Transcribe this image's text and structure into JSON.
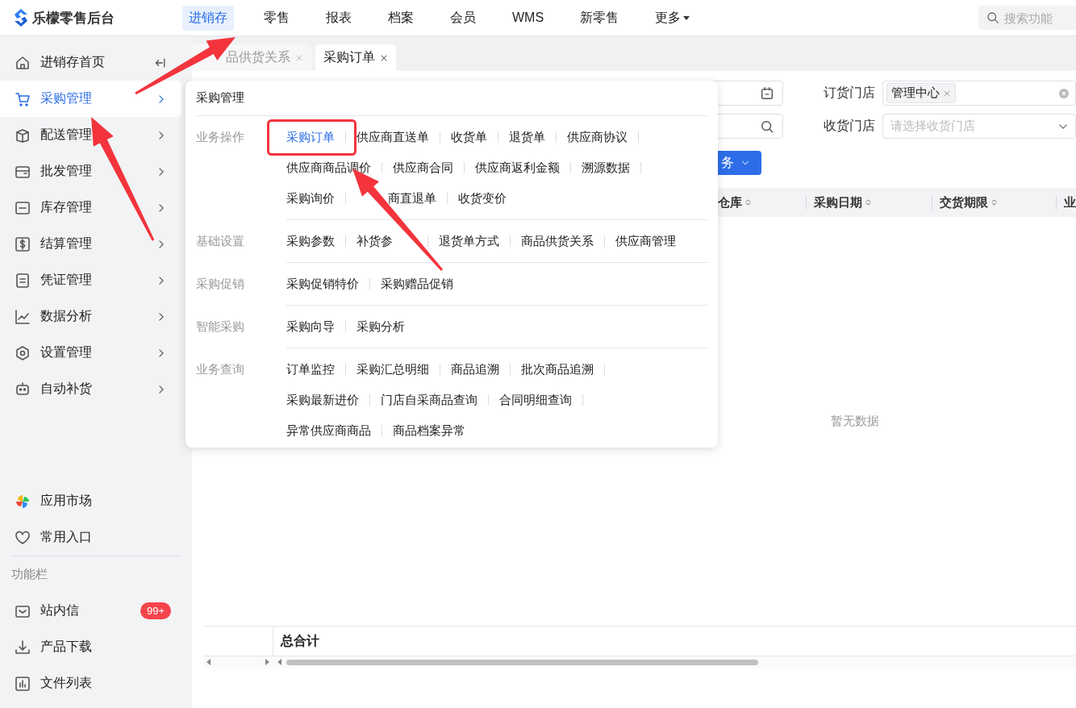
{
  "app": {
    "title": "乐檬零售后台"
  },
  "top_nav": [
    {
      "label": "进销存",
      "selected": true,
      "kind": "link"
    },
    {
      "label": "零售",
      "selected": false,
      "kind": "link"
    },
    {
      "label": "报表",
      "selected": false,
      "kind": "link"
    },
    {
      "label": "档案",
      "selected": false,
      "kind": "link"
    },
    {
      "label": "会员",
      "selected": false,
      "kind": "link"
    },
    {
      "label": "WMS",
      "selected": false,
      "kind": "link"
    },
    {
      "label": "新零售",
      "selected": false,
      "kind": "link"
    },
    {
      "label": "更多",
      "selected": false,
      "kind": "dropdown"
    }
  ],
  "search": {
    "placeholder": "搜索功能"
  },
  "sidebar": {
    "items": [
      {
        "label": "进销存首页",
        "kind": "collapse",
        "selected": false
      },
      {
        "label": "采购管理",
        "kind": "submenu",
        "selected": true
      },
      {
        "label": "配送管理",
        "kind": "submenu",
        "selected": false
      },
      {
        "label": "批发管理",
        "kind": "submenu",
        "selected": false
      },
      {
        "label": "库存管理",
        "kind": "submenu",
        "selected": false
      },
      {
        "label": "结算管理",
        "kind": "submenu",
        "selected": false
      },
      {
        "label": "凭证管理",
        "kind": "submenu",
        "selected": false
      },
      {
        "label": "数据分析",
        "kind": "submenu",
        "selected": false
      },
      {
        "label": "设置管理",
        "kind": "submenu",
        "selected": false
      },
      {
        "label": "自动补货",
        "kind": "submenu",
        "selected": false
      }
    ],
    "shortcuts": [
      {
        "label": "应用市场"
      },
      {
        "label": "常用入口"
      }
    ],
    "section_label": "功能栏",
    "tools": [
      {
        "label": "站内信",
        "badge": "99+"
      },
      {
        "label": "产品下载"
      },
      {
        "label": "文件列表"
      }
    ]
  },
  "tabs": [
    {
      "label": "品供货关系",
      "selected": false,
      "kind": "cut-start"
    },
    {
      "label": "采购订单",
      "selected": true,
      "kind": "full"
    }
  ],
  "filters": {
    "fields": [
      {
        "label": "订货门店",
        "tag": "管理中心"
      },
      {
        "label": "收货门店",
        "placeholder": "请选择收货门店"
      }
    ]
  },
  "action_button": {
    "label": "务"
  },
  "table": {
    "columns": [
      "仓库",
      "采购日期",
      "交货期限",
      "业"
    ],
    "empty_text": "暂无数据",
    "footer_label": "总合计"
  },
  "popup": {
    "title": "采购管理",
    "groups": [
      {
        "label": "业务操作",
        "rows": [
          {
            "links": [
              {
                "label": "采购订单",
                "selected": true,
                "kind": "full"
              },
              {
                "label": "供应商直送单",
                "selected": false,
                "kind": "full"
              },
              {
                "label": "收货单",
                "selected": false,
                "kind": "full"
              },
              {
                "label": "退货单",
                "selected": false,
                "kind": "full"
              },
              {
                "label": "供应商协议",
                "selected": false,
                "kind": "full"
              }
            ]
          },
          {
            "links": [
              {
                "label": "供应商商品调价",
                "selected": false,
                "kind": "full"
              },
              {
                "label": "供应商合同",
                "selected": false,
                "kind": "full"
              },
              {
                "label": "供应商返利金额",
                "selected": false,
                "kind": "full"
              },
              {
                "label": "溯源数据",
                "selected": false,
                "kind": "full"
              }
            ]
          },
          {
            "links": [
              {
                "label": "采购询价",
                "selected": false,
                "kind": "full"
              },
              {
                "label": "商直退单",
                "selected": false,
                "kind": "cut-start"
              },
              {
                "label": "收货变价",
                "selected": false,
                "kind": "full"
              }
            ]
          }
        ]
      },
      {
        "label": "基础设置",
        "rows": [
          {
            "links": [
              {
                "label": "采购参数",
                "selected": false,
                "kind": "full"
              },
              {
                "label": "补货参",
                "selected": false,
                "kind": "cut-end"
              },
              {
                "label": "退货单方式",
                "selected": false,
                "kind": "full"
              },
              {
                "label": "商品供货关系",
                "selected": false,
                "kind": "full"
              },
              {
                "label": "供应商管理",
                "selected": false,
                "kind": "full"
              }
            ]
          }
        ]
      },
      {
        "label": "采购促销",
        "rows": [
          {
            "links": [
              {
                "label": "采购促销特价",
                "selected": false,
                "kind": "full"
              },
              {
                "label": "采购赠品促销",
                "selected": false,
                "kind": "full"
              }
            ]
          }
        ]
      },
      {
        "label": "智能采购",
        "rows": [
          {
            "links": [
              {
                "label": "采购向导",
                "selected": false,
                "kind": "full"
              },
              {
                "label": "采购分析",
                "selected": false,
                "kind": "full"
              }
            ]
          }
        ]
      },
      {
        "label": "业务查询",
        "rows": [
          {
            "links": [
              {
                "label": "订单监控",
                "selected": false,
                "kind": "full"
              },
              {
                "label": "采购汇总明细",
                "selected": false,
                "kind": "full"
              },
              {
                "label": "商品追溯",
                "selected": false,
                "kind": "full"
              },
              {
                "label": "批次商品追溯",
                "selected": false,
                "kind": "full"
              }
            ]
          },
          {
            "links": [
              {
                "label": "采购最新进价",
                "selected": false,
                "kind": "full"
              },
              {
                "label": "门店自采商品查询",
                "selected": false,
                "kind": "full"
              },
              {
                "label": "合同明细查询",
                "selected": false,
                "kind": "full"
              }
            ]
          },
          {
            "links": [
              {
                "label": "异常供应商商品",
                "selected": false,
                "kind": "full"
              },
              {
                "label": "商品档案异常",
                "selected": false,
                "kind": "full"
              }
            ]
          }
        ]
      }
    ]
  }
}
